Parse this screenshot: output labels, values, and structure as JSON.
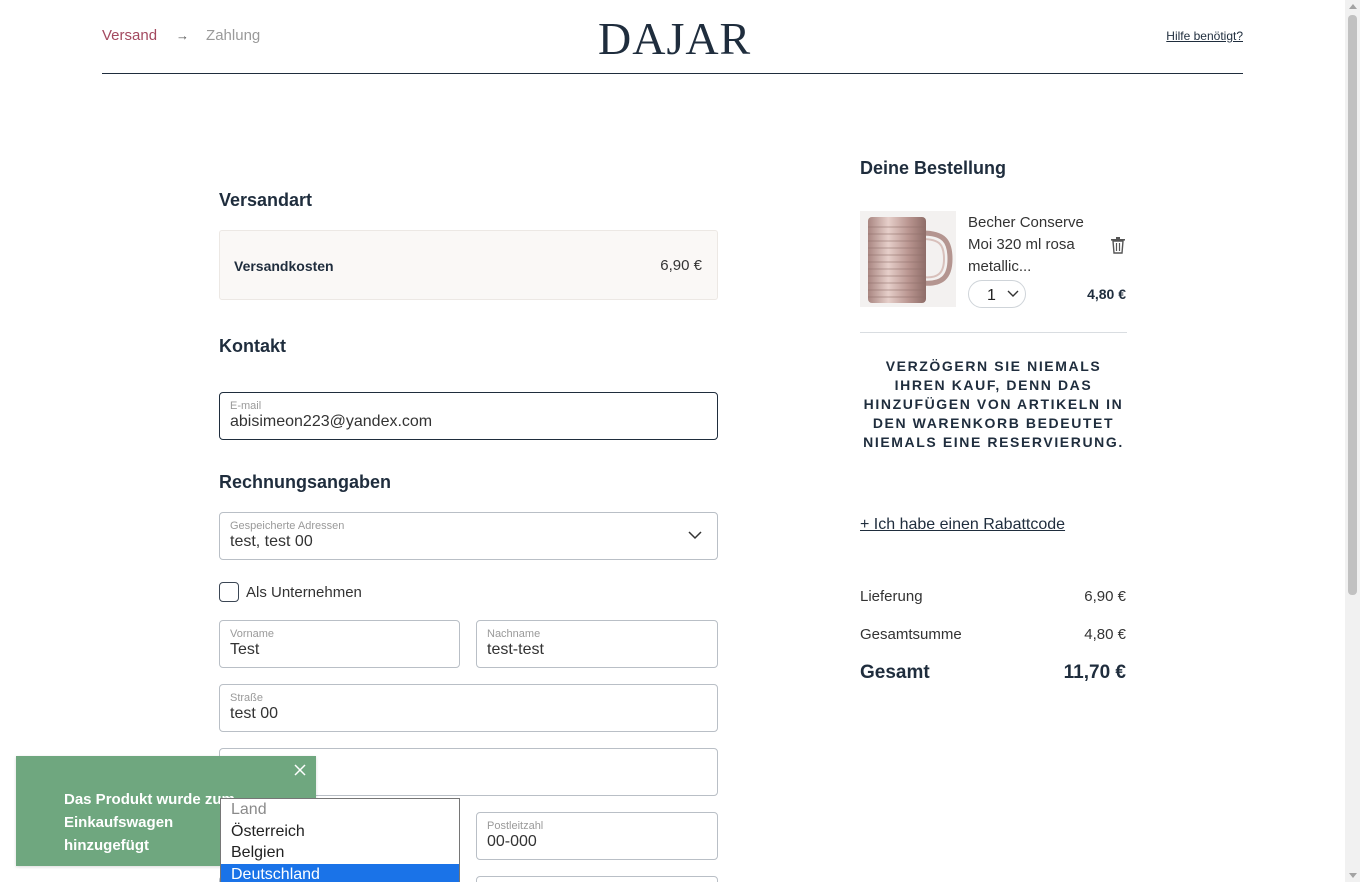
{
  "header": {
    "steps": [
      "Versand",
      "Zahlung"
    ],
    "step_arrow": "→",
    "logo": "DAJAR",
    "help_link": "Hilfe benötigt?"
  },
  "shipping": {
    "title": "Versandart",
    "cost_label": "Versandkosten",
    "cost_value": "6,90 €"
  },
  "contact": {
    "title": "Kontakt",
    "email_label": "E-mail",
    "email_value": "abisimeon223@yandex.com"
  },
  "billing": {
    "title": "Rechnungsangaben",
    "saved_label": "Gespeicherte Adressen",
    "saved_value": "test, test 00",
    "company_checkbox": "Als Unternehmen",
    "firstname_label": "Vorname",
    "firstname_value": "Test",
    "lastname_label": "Nachname",
    "lastname_value": "test-test",
    "street_label": "Straße",
    "street_value": "test 00",
    "postal_label": "Postleitzahl",
    "postal_value": "00-000"
  },
  "country_dropdown": {
    "options": [
      "Land",
      "Österreich",
      "Belgien",
      "Deutschland"
    ],
    "selected": "Deutschland"
  },
  "toast": {
    "message": "Das Produkt wurde zum Einkaufswagen hinzugefügt"
  },
  "order": {
    "title": "Deine Bestellung",
    "item_name": "Becher Conserve Moi 320 ml rosa metallic...",
    "item_qty": "1",
    "item_price": "4,80 €",
    "notice": "VERZÖGERN SIE NIEMALS IHREN KAUF, DENN DAS HINZUFÜGEN VON ARTIKELN IN DEN WARENKORB BEDEUTET NIEMALS EINE RESERVIERUNG.",
    "discount_link": "+ Ich habe einen Rabattcode",
    "delivery_label": "Lieferung",
    "delivery_value": "6,90 €",
    "subtotal_label": "Gesamtsumme",
    "subtotal_value": "4,80 €",
    "total_label": "Gesamt",
    "total_value": "11,70 €"
  },
  "colors": {
    "accent": "#a3495f",
    "text": "#1f2d3d",
    "toast_bg": "#6fa77f",
    "select_highlight": "#1a73e8"
  }
}
